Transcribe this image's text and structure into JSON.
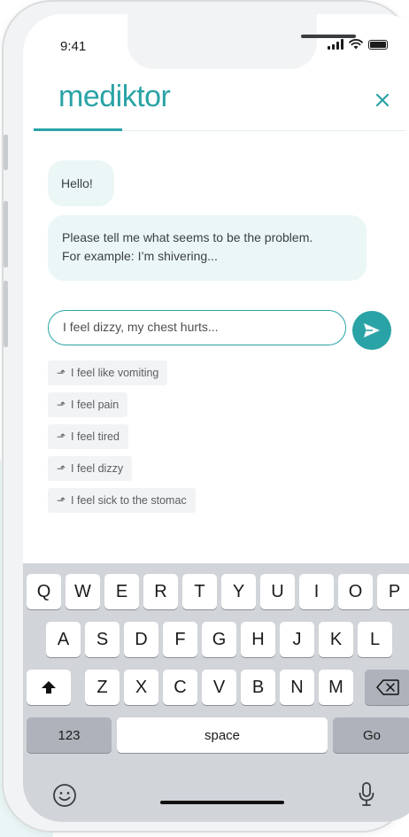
{
  "status_bar": {
    "time": "9:41"
  },
  "header": {
    "logo": "mediktor",
    "close_icon": "close-icon"
  },
  "chat": {
    "messages": [
      {
        "text": "Hello!"
      },
      {
        "line1": "Please tell me what seems to be the problem.",
        "line2": "For example: I’m shivering..."
      }
    ]
  },
  "input": {
    "value": "I feel dizzy, my chest hurts...",
    "send_icon": "send-icon"
  },
  "suggestions": [
    {
      "label": "I feel like vomiting"
    },
    {
      "label": "I feel pain"
    },
    {
      "label": "I feel tired"
    },
    {
      "label": "I feel dizzy"
    },
    {
      "label": "I feel sick to the stomac"
    }
  ],
  "keyboard": {
    "row1": [
      "Q",
      "W",
      "E",
      "R",
      "T",
      "Y",
      "U",
      "I",
      "O",
      "P"
    ],
    "row2": [
      "A",
      "S",
      "D",
      "F",
      "G",
      "H",
      "J",
      "K",
      "L"
    ],
    "row3": [
      "Z",
      "X",
      "C",
      "V",
      "B",
      "N",
      "M"
    ],
    "numbers_label": "123",
    "space_label": "space",
    "go_label": "Go",
    "icons": [
      "shift-icon",
      "backspace-icon",
      "emoji-icon",
      "microphone-icon"
    ]
  },
  "colors": {
    "brand": "#2aa3a6",
    "bubble": "#ebf6f6",
    "keyboard_bg": "#d1d4d9"
  }
}
